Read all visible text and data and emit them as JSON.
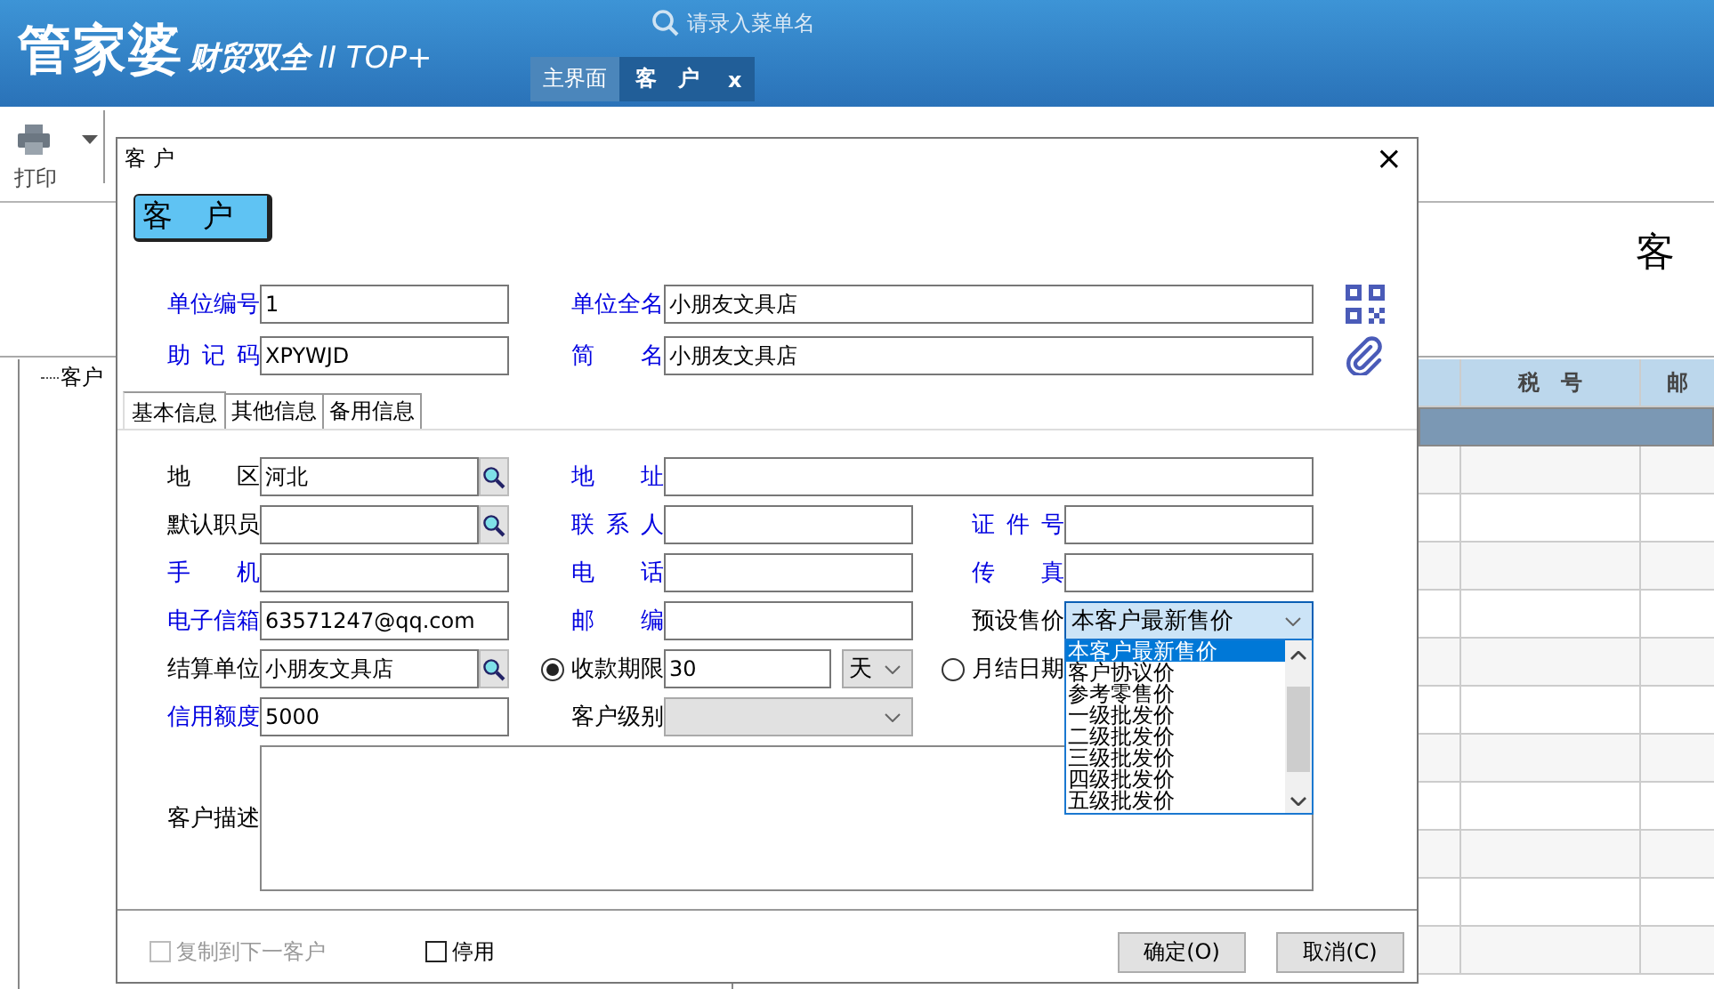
{
  "app": {
    "logo": "管家婆",
    "subtitle": "财贸双全",
    "edition": "II TOP+",
    "search": {
      "placeholder": "请录入菜单名"
    },
    "tabs": [
      {
        "label": "主界面",
        "selected": false
      },
      {
        "label": "客　户",
        "selected": true,
        "close": "x"
      }
    ]
  },
  "toolbar": {
    "items": [
      {
        "label": "打印"
      }
    ]
  },
  "background": {
    "title": "客",
    "tree": [
      {
        "label": "客户"
      }
    ],
    "table": {
      "columns": [
        "税　号",
        "邮"
      ],
      "rows": [
        {
          "selected": true
        },
        {
          "selected": false
        },
        {
          "selected": false
        },
        {
          "selected": false
        },
        {
          "selected": false
        },
        {
          "selected": false
        },
        {
          "selected": false
        },
        {
          "selected": false
        },
        {
          "selected": false
        },
        {
          "selected": false
        },
        {
          "selected": false
        },
        {
          "selected": false
        }
      ]
    }
  },
  "dialog": {
    "title": "客 户",
    "close": "×",
    "badge": "客　户",
    "top_rows": [
      [
        {
          "label": "单位编号",
          "highlight": true,
          "value": "1"
        },
        {
          "label": "单位全名",
          "highlight": true,
          "value": "小朋友文具店",
          "wide": true
        }
      ],
      [
        {
          "label": "助记码",
          "highlight": true,
          "value": "XPYWJD"
        },
        {
          "label": "简名",
          "highlight": true,
          "value": "小朋友文具店",
          "wide": true
        }
      ]
    ],
    "tabs": [
      {
        "label": "基本信息",
        "selected": true
      },
      {
        "label": "其他信息",
        "selected": false
      },
      {
        "label": "备用信息",
        "selected": false
      }
    ],
    "rows": [
      [
        {
          "label": "地区",
          "highlight": false,
          "kind": "lookup",
          "value": "河北"
        },
        {
          "label": "地址",
          "highlight": true,
          "kind": "text",
          "wide": true
        }
      ],
      [
        {
          "label": "默认职员",
          "highlight": false,
          "kind": "lookup"
        },
        {
          "label": "联系人",
          "highlight": true,
          "kind": "text"
        },
        {
          "label": "证件号",
          "highlight": true,
          "kind": "text"
        }
      ],
      [
        {
          "label": "手机",
          "highlight": true,
          "kind": "text"
        },
        {
          "label": "电话",
          "highlight": true,
          "kind": "text"
        },
        {
          "label": "传真",
          "highlight": true,
          "kind": "text"
        }
      ],
      [
        {
          "label": "电子信箱",
          "highlight": true,
          "kind": "text",
          "value": "63571247@qq.com"
        },
        {
          "label": "邮编",
          "highlight": true,
          "kind": "text"
        },
        {
          "label": "预设售价",
          "highlight": false,
          "kind": "select",
          "value": "本客户最新售价",
          "expanded": true,
          "options": [
            {
              "label": "本客户最新售价",
              "selected": true
            },
            {
              "label": "客户协议价",
              "selected": false
            },
            {
              "label": "参考零售价",
              "selected": false
            },
            {
              "label": "一级批发价",
              "selected": false
            },
            {
              "label": "二级批发价",
              "selected": false
            },
            {
              "label": "三级批发价",
              "selected": false
            },
            {
              "label": "四级批发价",
              "selected": false
            },
            {
              "label": "五级批发价",
              "selected": false
            }
          ]
        }
      ],
      [
        {
          "label": "结算单位",
          "highlight": false,
          "kind": "lookup",
          "value": "小朋友文具店"
        },
        {
          "label": "收款期限",
          "highlight": false,
          "kind": "period",
          "selected": true,
          "value": "30",
          "unit": "天"
        },
        {
          "label": "月结日期",
          "highlight": false,
          "kind": "radio",
          "selected": false
        }
      ],
      [
        {
          "label": "信用额度",
          "highlight": true,
          "kind": "text",
          "value": "5000"
        },
        {
          "label": "客户级别",
          "highlight": false,
          "kind": "select",
          "disabled": true
        }
      ]
    ],
    "description": {
      "label": "客户描述"
    },
    "checks": [
      {
        "label": "复制到下一客户",
        "checked": false,
        "disabled": true
      },
      {
        "label": "停用",
        "checked": false,
        "disabled": false
      }
    ],
    "buttons": [
      "确定(O)",
      "取消(C)"
    ]
  }
}
